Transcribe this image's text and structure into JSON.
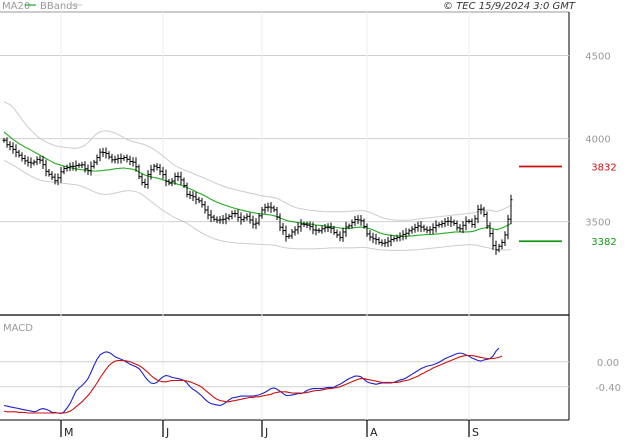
{
  "header": {
    "ma_label": "MA20",
    "bb_label": "BBands",
    "timestamp": "© TEC 15/9/2024 3:0 GMT"
  },
  "colors": {
    "ma": "#22aa22",
    "bbands": "#cccccc",
    "price": "#000000",
    "resistance": "#cc1111",
    "support": "#119911",
    "macd": "#2222cc",
    "signal": "#cc1111",
    "grid": "#d0d0d0",
    "axis": "#000000"
  },
  "chart_data": [
    {
      "type": "bar",
      "subtype": "ohlc",
      "title": "",
      "ylim": [
        2950,
        4750
      ],
      "yticks": [
        3500,
        4000,
        4500
      ],
      "ytick_labels": [
        "3500",
        "4000",
        "4500"
      ],
      "x_labels": [
        "M",
        "J",
        "J",
        "A",
        "S"
      ],
      "x_label_index": [
        19,
        53,
        86,
        121,
        155
      ],
      "n_bars": 170,
      "close": [
        3990,
        3963,
        3952,
        3935,
        3918,
        3900,
        3880,
        3866,
        3857,
        3852,
        3859,
        3875,
        3870,
        3843,
        3803,
        3785,
        3768,
        3746,
        3764,
        3800,
        3820,
        3825,
        3833,
        3833,
        3838,
        3840,
        3842,
        3818,
        3807,
        3833,
        3858,
        3886,
        3918,
        3916,
        3910,
        3889,
        3872,
        3875,
        3880,
        3880,
        3886,
        3875,
        3862,
        3858,
        3830,
        3770,
        3736,
        3724,
        3784,
        3812,
        3834,
        3826,
        3803,
        3783,
        3743,
        3732,
        3744,
        3772,
        3770,
        3751,
        3717,
        3664,
        3658,
        3650,
        3635,
        3625,
        3602,
        3570,
        3540,
        3527,
        3514,
        3509,
        3511,
        3514,
        3521,
        3532,
        3549,
        3548,
        3526,
        3512,
        3523,
        3532,
        3510,
        3485,
        3491,
        3535,
        3570,
        3586,
        3588,
        3583,
        3571,
        3528,
        3466,
        3446,
        3410,
        3414,
        3438,
        3450,
        3469,
        3485,
        3482,
        3479,
        3470,
        3450,
        3448,
        3445,
        3457,
        3464,
        3464,
        3460,
        3434,
        3420,
        3404,
        3438,
        3468,
        3475,
        3495,
        3513,
        3510,
        3505,
        3471,
        3426,
        3407,
        3397,
        3392,
        3375,
        3370,
        3373,
        3382,
        3392,
        3398,
        3404,
        3413,
        3423,
        3430,
        3445,
        3455,
        3465,
        3474,
        3467,
        3454,
        3448,
        3451,
        3464,
        3478,
        3482,
        3489,
        3500,
        3502,
        3498,
        3489,
        3463,
        3457,
        3478,
        3502,
        3502,
        3483,
        3517,
        3574,
        3575,
        3543,
        3474,
        3428,
        3356,
        3330,
        3352,
        3375,
        3420,
        3515,
        3632
      ],
      "ma20": [
        4040,
        4025,
        4010,
        3995,
        3983,
        3970,
        3960,
        3948,
        3940,
        3930,
        3920,
        3910,
        3900,
        3890,
        3880,
        3870,
        3860,
        3850,
        3845,
        3840,
        3835,
        3830,
        3826,
        3822,
        3818,
        3815,
        3812,
        3810,
        3808,
        3806,
        3805,
        3805,
        3806,
        3808,
        3810,
        3812,
        3815,
        3818,
        3820,
        3822,
        3823,
        3820,
        3818,
        3815,
        3810,
        3800,
        3790,
        3780,
        3775,
        3770,
        3766,
        3762,
        3758,
        3752,
        3745,
        3740,
        3735,
        3730,
        3725,
        3720,
        3712,
        3705,
        3698,
        3690,
        3680,
        3672,
        3664,
        3655,
        3645,
        3635,
        3626,
        3617,
        3610,
        3603,
        3597,
        3591,
        3585,
        3580,
        3575,
        3570,
        3566,
        3562,
        3558,
        3554,
        3551,
        3548,
        3546,
        3544,
        3542,
        3540,
        3536,
        3530,
        3522,
        3515,
        3508,
        3503,
        3500,
        3497,
        3494,
        3492,
        3490,
        3488,
        3486,
        3483,
        3480,
        3478,
        3476,
        3474,
        3472,
        3470,
        3468,
        3465,
        3462,
        3460,
        3458,
        3460,
        3462,
        3464,
        3466,
        3467,
        3466,
        3462,
        3456,
        3450,
        3442,
        3434,
        3428,
        3424,
        3420,
        3418,
        3416,
        3414,
        3413,
        3412,
        3412,
        3413,
        3414,
        3416,
        3418,
        3420,
        3421,
        3422,
        3423,
        3424,
        3425,
        3427,
        3429,
        3431,
        3433,
        3435,
        3437,
        3438,
        3438,
        3438,
        3438,
        3439,
        3440,
        3445,
        3452,
        3458,
        3462,
        3465,
        3462,
        3458,
        3452,
        3455,
        3462,
        3470,
        3478,
        3490
      ],
      "bb_upper": [
        4220,
        4213,
        4205,
        4188,
        4165,
        4140,
        4115,
        4092,
        4070,
        4050,
        4032,
        4015,
        4002,
        3990,
        3980,
        3972,
        3965,
        3958,
        3953,
        3950,
        3948,
        3946,
        3944,
        3942,
        3942,
        3945,
        3950,
        3960,
        3975,
        3995,
        4015,
        4030,
        4040,
        4045,
        4047,
        4045,
        4040,
        4033,
        4025,
        4015,
        4005,
        3995,
        3988,
        3982,
        3977,
        3972,
        3968,
        3962,
        3955,
        3945,
        3935,
        3922,
        3910,
        3895,
        3880,
        3865,
        3850,
        3838,
        3828,
        3820,
        3812,
        3805,
        3798,
        3790,
        3782,
        3775,
        3768,
        3760,
        3752,
        3744,
        3736,
        3728,
        3721,
        3714,
        3708,
        3702,
        3697,
        3692,
        3688,
        3684,
        3680,
        3676,
        3672,
        3668,
        3664,
        3660,
        3656,
        3653,
        3650,
        3648,
        3645,
        3640,
        3632,
        3622,
        3612,
        3602,
        3594,
        3587,
        3581,
        3577,
        3574,
        3571,
        3569,
        3567,
        3565,
        3563,
        3561,
        3560,
        3560,
        3560,
        3560,
        3560,
        3560,
        3560,
        3560,
        3562,
        3564,
        3565,
        3566,
        3567,
        3566,
        3562,
        3556,
        3548,
        3540,
        3532,
        3525,
        3520,
        3515,
        3512,
        3510,
        3509,
        3508,
        3508,
        3508,
        3509,
        3510,
        3512,
        3515,
        3518,
        3520,
        3522,
        3524,
        3526,
        3528,
        3530,
        3532,
        3534,
        3536,
        3538,
        3540,
        3542,
        3544,
        3546,
        3548,
        3550,
        3552,
        3555,
        3560,
        3565,
        3568,
        3570,
        3568,
        3565,
        3560,
        3565,
        3572,
        3580,
        3588,
        3600
      ],
      "bb_lower": [
        3870,
        3860,
        3850,
        3840,
        3830,
        3818,
        3805,
        3795,
        3785,
        3775,
        3765,
        3757,
        3750,
        3745,
        3742,
        3740,
        3738,
        3736,
        3734,
        3732,
        3730,
        3728,
        3726,
        3724,
        3722,
        3718,
        3712,
        3705,
        3697,
        3688,
        3680,
        3673,
        3668,
        3665,
        3664,
        3665,
        3668,
        3672,
        3676,
        3680,
        3684,
        3686,
        3686,
        3684,
        3680,
        3674,
        3664,
        3650,
        3636,
        3622,
        3608,
        3594,
        3580,
        3568,
        3556,
        3545,
        3534,
        3524,
        3515,
        3507,
        3500,
        3490,
        3478,
        3466,
        3454,
        3442,
        3432,
        3422,
        3413,
        3405,
        3398,
        3392,
        3387,
        3383,
        3380,
        3377,
        3375,
        3373,
        3371,
        3370,
        3369,
        3368,
        3367,
        3366,
        3365,
        3364,
        3363,
        3362,
        3361,
        3360,
        3358,
        3355,
        3350,
        3346,
        3342,
        3340,
        3338,
        3337,
        3336,
        3336,
        3336,
        3336,
        3336,
        3336,
        3337,
        3338,
        3339,
        3340,
        3341,
        3342,
        3342,
        3342,
        3342,
        3342,
        3342,
        3342,
        3342,
        3343,
        3344,
        3345,
        3345,
        3343,
        3340,
        3337,
        3334,
        3332,
        3330,
        3329,
        3328,
        3327,
        3327,
        3327,
        3327,
        3327,
        3327,
        3328,
        3329,
        3330,
        3331,
        3333,
        3335,
        3337,
        3339,
        3341,
        3343,
        3345,
        3347,
        3349,
        3351,
        3353,
        3355,
        3357,
        3358,
        3359,
        3360,
        3361,
        3361,
        3360,
        3356,
        3352,
        3348,
        3344,
        3340,
        3336,
        3332,
        3330,
        3329,
        3329,
        3330,
        3332
      ],
      "levels": [
        {
          "name": "resistance",
          "value": 3832,
          "label": "3832"
        },
        {
          "name": "support",
          "value": 3382,
          "label": "3382"
        }
      ]
    },
    {
      "type": "line",
      "title": "MACD",
      "ylim": [
        -90,
        70
      ],
      "yticks": [
        0,
        -40
      ],
      "ytick_labels": [
        "0.00",
        "-0.40"
      ],
      "series": [
        {
          "name": "MACD",
          "values": [
            -70,
            -71,
            -72,
            -73,
            -74,
            -75,
            -76,
            -77,
            -78,
            -79,
            -80,
            -79,
            -76,
            -75,
            -76,
            -78,
            -81,
            -81,
            -82,
            -83,
            -80,
            -74,
            -67,
            -57,
            -47,
            -42,
            -38,
            -33,
            -27,
            -17,
            -6,
            4,
            11,
            14,
            16,
            15,
            12,
            8,
            6,
            4,
            2,
            -1,
            -4,
            -6,
            -8,
            -11,
            -17,
            -24,
            -30,
            -34,
            -35,
            -33,
            -28,
            -24,
            -22,
            -23,
            -25,
            -26,
            -27,
            -28,
            -30,
            -34,
            -40,
            -44,
            -47,
            -51,
            -55,
            -60,
            -64,
            -67,
            -68,
            -69,
            -70,
            -68,
            -65,
            -61,
            -58,
            -57,
            -56,
            -55,
            -55,
            -55,
            -55,
            -55,
            -54,
            -53,
            -51,
            -49,
            -46,
            -43,
            -42,
            -44,
            -47,
            -51,
            -54,
            -54,
            -53,
            -52,
            -51,
            -51,
            -49,
            -46,
            -44,
            -43,
            -43,
            -43,
            -43,
            -42,
            -41,
            -41,
            -41,
            -38,
            -36,
            -33,
            -30,
            -27,
            -25,
            -23,
            -23,
            -24,
            -28,
            -32,
            -34,
            -35,
            -36,
            -35,
            -34,
            -34,
            -34,
            -34,
            -33,
            -31,
            -29,
            -28,
            -26,
            -23,
            -20,
            -17,
            -14,
            -11,
            -9,
            -7,
            -6,
            -5,
            -3,
            -1,
            2,
            5,
            7,
            9,
            11,
            13,
            14,
            13,
            11,
            9,
            6,
            4,
            2,
            1,
            3,
            4,
            5,
            9,
            17,
            22
          ],
          "color_key": "macd"
        },
        {
          "name": "Signal",
          "values": [
            -79,
            -80,
            -80,
            -80,
            -80,
            -81,
            -81,
            -81,
            -82,
            -82,
            -82,
            -82,
            -82,
            -82,
            -82,
            -82,
            -82,
            -82,
            -82,
            -82,
            -82,
            -81,
            -79,
            -76,
            -72,
            -68,
            -64,
            -59,
            -54,
            -48,
            -41,
            -34,
            -26,
            -19,
            -12,
            -6,
            -2,
            1,
            2,
            2,
            2,
            1,
            0,
            -2,
            -4,
            -6,
            -9,
            -13,
            -17,
            -22,
            -26,
            -29,
            -31,
            -32,
            -32,
            -31,
            -30,
            -30,
            -30,
            -30,
            -30,
            -31,
            -32,
            -34,
            -36,
            -38,
            -41,
            -45,
            -49,
            -53,
            -57,
            -60,
            -62,
            -63,
            -64,
            -64,
            -63,
            -62,
            -61,
            -60,
            -59,
            -58,
            -57,
            -57,
            -56,
            -56,
            -55,
            -54,
            -53,
            -52,
            -50,
            -49,
            -48,
            -48,
            -48,
            -49,
            -50,
            -50,
            -50,
            -50,
            -50,
            -49,
            -48,
            -47,
            -46,
            -46,
            -45,
            -44,
            -43,
            -43,
            -42,
            -41,
            -40,
            -38,
            -36,
            -34,
            -32,
            -30,
            -28,
            -27,
            -27,
            -28,
            -29,
            -30,
            -31,
            -32,
            -33,
            -33,
            -33,
            -33,
            -33,
            -33,
            -32,
            -31,
            -30,
            -29,
            -27,
            -25,
            -23,
            -20,
            -18,
            -15,
            -13,
            -10,
            -8,
            -6,
            -4,
            -2,
            0,
            2,
            4,
            6,
            8,
            9,
            10,
            10,
            10,
            9,
            8,
            7,
            6,
            5,
            5,
            5,
            6,
            7,
            9
          ],
          "color_key": "signal"
        }
      ]
    }
  ]
}
